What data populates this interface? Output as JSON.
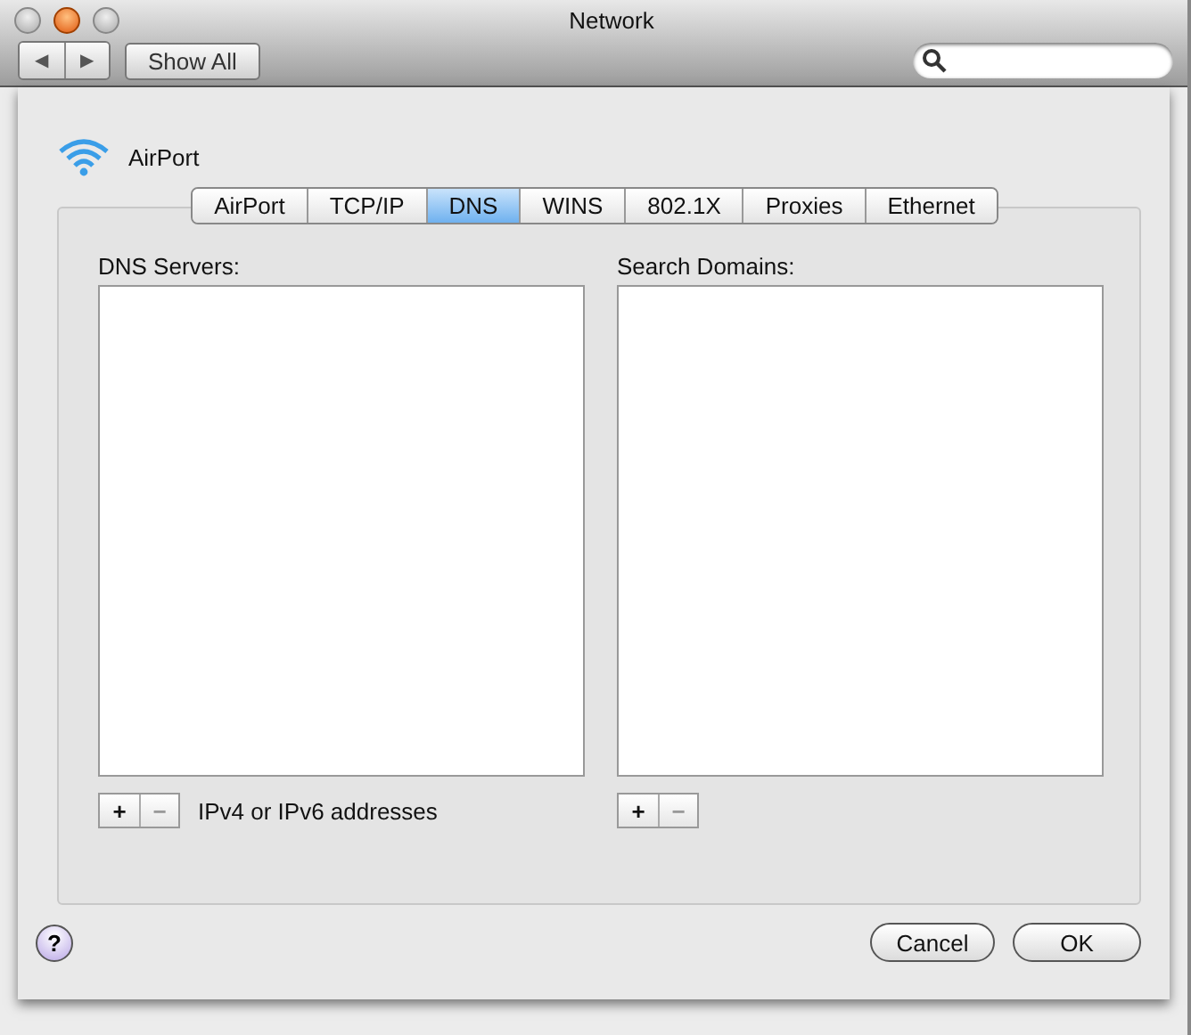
{
  "window": {
    "title": "Network"
  },
  "toolbar": {
    "back": "◀",
    "forward": "▶",
    "show_all": "Show All"
  },
  "header": {
    "label": "AirPort"
  },
  "tabs": [
    {
      "label": "AirPort",
      "selected": false
    },
    {
      "label": "TCP/IP",
      "selected": false
    },
    {
      "label": "DNS",
      "selected": true
    },
    {
      "label": "WINS",
      "selected": false
    },
    {
      "label": "802.1X",
      "selected": false
    },
    {
      "label": "Proxies",
      "selected": false
    },
    {
      "label": "Ethernet",
      "selected": false
    }
  ],
  "dns_servers": {
    "label": "DNS Servers:",
    "add": "+",
    "remove": "−",
    "hint": "IPv4 or IPv6 addresses"
  },
  "search_domains": {
    "label": "Search Domains:",
    "add": "+",
    "remove": "−"
  },
  "help": "?",
  "buttons": [
    {
      "label": "Cancel",
      "default": false
    },
    {
      "label": "OK",
      "default": false
    }
  ]
}
